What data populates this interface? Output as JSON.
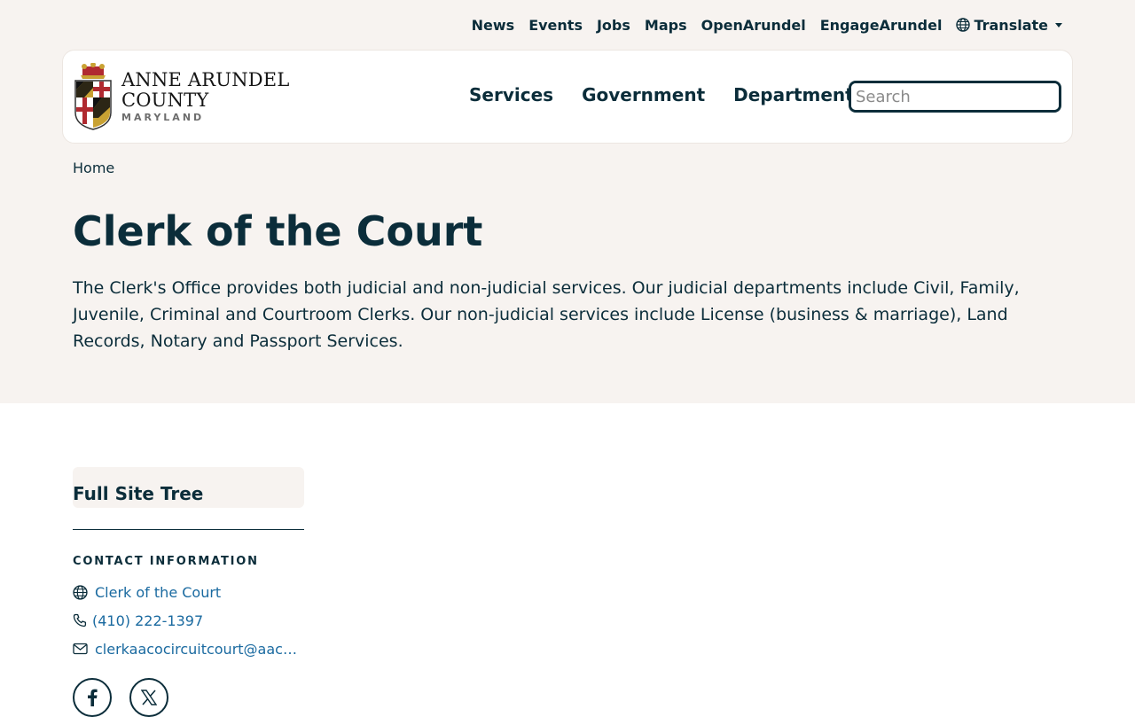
{
  "utility_nav": {
    "items": [
      "News",
      "Events",
      "Jobs",
      "Maps",
      "OpenArundel",
      "EngageArundel"
    ],
    "translate": "Translate"
  },
  "logo": {
    "line1": "ANNE ARUNDEL",
    "line2": "COUNTY",
    "line3": "MARYLAND"
  },
  "main_nav": {
    "items": [
      "Services",
      "Government",
      "Departments"
    ]
  },
  "search": {
    "placeholder": "Search"
  },
  "breadcrumb": {
    "home": "Home"
  },
  "page": {
    "title": "Clerk of the Court",
    "intro": "The Clerk's Office provides both judicial and non-judicial services. Our judicial departments include Civil, Family, Juvenile, Criminal and Courtroom Clerks. Our non-judicial services include License (business & marriage), Land Records, Notary and Passport Services."
  },
  "sidebar": {
    "site_tree": "Full Site Tree",
    "contact_heading": "CONTACT INFORMATION",
    "website": "Clerk of the Court",
    "phone": "(410) 222-1397",
    "email": "clerkaacocircuitcourt@aacou..."
  },
  "social": {
    "facebook_icon": "facebook-icon",
    "x_icon": "x-icon"
  },
  "colors": {
    "primary": "#0b2d3a",
    "link": "#1a6aa0",
    "hero_bg": "#f7f3f0"
  }
}
